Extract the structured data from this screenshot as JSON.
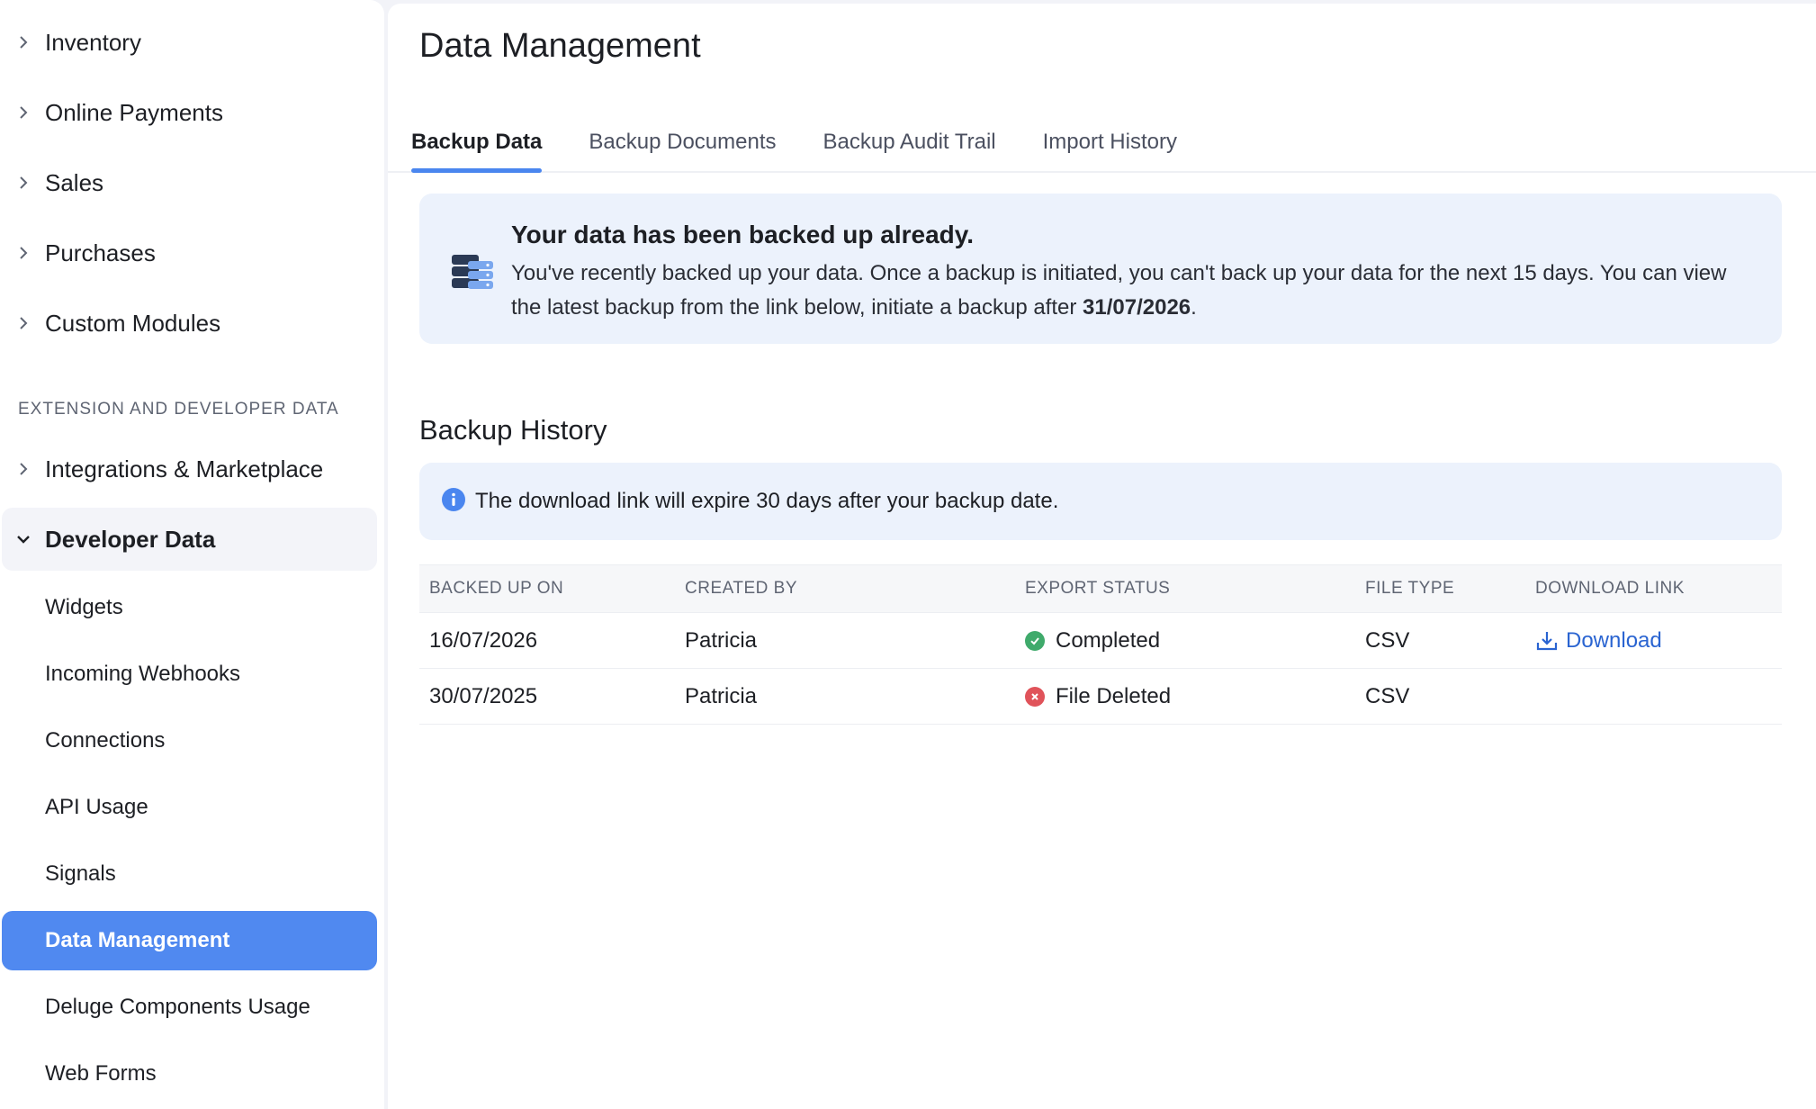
{
  "sidebar": {
    "items": [
      {
        "label": "Inventory"
      },
      {
        "label": "Online Payments"
      },
      {
        "label": "Sales"
      },
      {
        "label": "Purchases"
      },
      {
        "label": "Custom Modules"
      }
    ],
    "section_label": "EXTENSION AND DEVELOPER DATA",
    "integrations_label": "Integrations & Marketplace",
    "developer_data_label": "Developer Data",
    "sub_items": [
      {
        "label": "Widgets"
      },
      {
        "label": "Incoming Webhooks"
      },
      {
        "label": "Connections"
      },
      {
        "label": "API Usage"
      },
      {
        "label": "Signals"
      },
      {
        "label": "Data Management"
      },
      {
        "label": "Deluge Components Usage"
      },
      {
        "label": "Web Forms"
      }
    ]
  },
  "main": {
    "title": "Data Management",
    "tabs": [
      {
        "label": "Backup Data"
      },
      {
        "label": "Backup Documents"
      },
      {
        "label": "Backup Audit Trail"
      },
      {
        "label": "Import History"
      }
    ],
    "notice": {
      "title": "Your data has been backed up already.",
      "body_prefix": "You've recently backed up your data. Once a backup is initiated, you can't back up your data for the next 15 days. You can view the latest backup from the link below, initiate a backup after ",
      "body_date": "31/07/2026",
      "body_suffix": "."
    },
    "history_title": "Backup History",
    "info_text": "The download link will expire 30 days after your backup date.",
    "table": {
      "headers": [
        "BACKED UP ON",
        "CREATED BY",
        "EXPORT STATUS",
        "FILE TYPE",
        "DOWNLOAD LINK"
      ],
      "rows": [
        {
          "backed_up_on": "16/07/2026",
          "created_by": "Patricia",
          "status": "Completed",
          "file_type": "CSV",
          "download": "Download"
        },
        {
          "backed_up_on": "30/07/2025",
          "created_by": "Patricia",
          "status": "File Deleted",
          "file_type": "CSV",
          "download": ""
        }
      ]
    }
  },
  "colors": {
    "accent": "#5089f0",
    "link": "#2a64d1",
    "success": "#3faa6b",
    "error": "#e0535a",
    "notice_bg": "#ecf2fc"
  }
}
